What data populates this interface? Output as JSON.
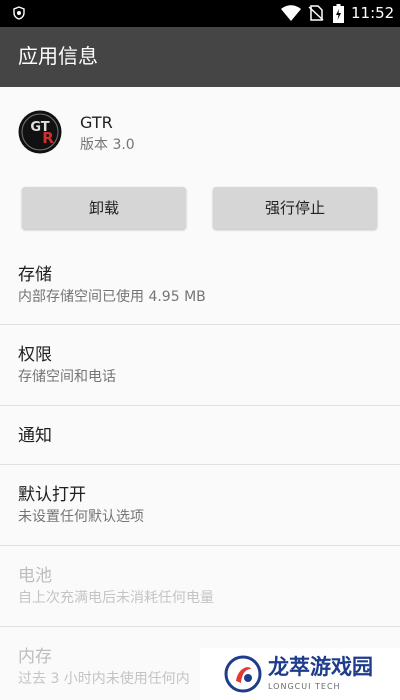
{
  "status_bar": {
    "time": "11:52",
    "icons": [
      "shield-icon",
      "wifi-icon",
      "no-sim-icon",
      "battery-charging-icon"
    ]
  },
  "app_bar": {
    "title": "应用信息"
  },
  "app": {
    "name": "GTR",
    "version": "版本 3.0",
    "icon": "gtr-logo-icon"
  },
  "buttons": {
    "uninstall": "卸载",
    "force_stop": "强行停止"
  },
  "rows": [
    {
      "title": "存储",
      "subtitle": "内部存储空间已使用 4.95 MB"
    },
    {
      "title": "权限",
      "subtitle": "存储空间和电话"
    },
    {
      "title": "通知"
    },
    {
      "title": "默认打开",
      "subtitle": "未设置任何默认选项"
    },
    {
      "title": "电池",
      "subtitle": "自上次充满电后未消耗任何电量"
    },
    {
      "title": "内存",
      "subtitle": "过去 3 小时内未使用任何内"
    }
  ],
  "watermark": {
    "brand": "龙萃游戏园",
    "sub": "LONGCUI TECH"
  }
}
